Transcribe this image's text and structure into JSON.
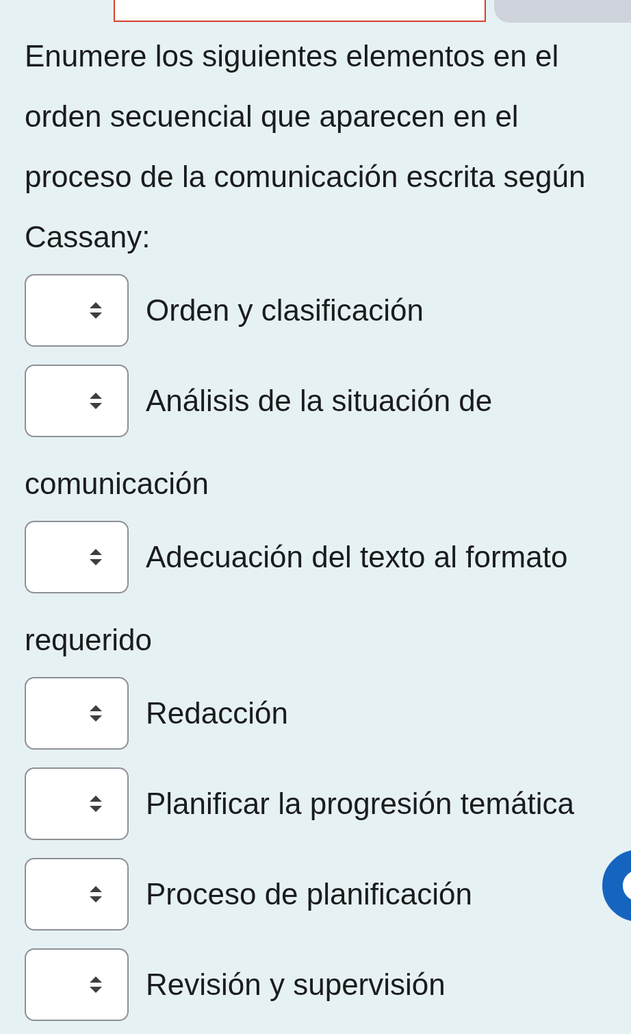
{
  "answer_field": {
    "invalid": true
  },
  "question": "Enumere los siguientes elementos en el orden secuencial que aparecen en el proceso de la comunicación escrita según Cassany:",
  "items": [
    {
      "label_lines": [
        "Orden y clasificación"
      ]
    },
    {
      "label_lines": [
        "Análisis de la situación de",
        "comunicación"
      ]
    },
    {
      "label_lines": [
        "Adecuación del texto al formato",
        "requerido"
      ]
    },
    {
      "label_lines": [
        "Redacción"
      ]
    },
    {
      "label_lines": [
        "Planificar la progresión temática"
      ]
    },
    {
      "label_lines": [
        "Proceso de planificación"
      ]
    },
    {
      "label_lines": [
        "Revisión y supervisión"
      ]
    }
  ]
}
